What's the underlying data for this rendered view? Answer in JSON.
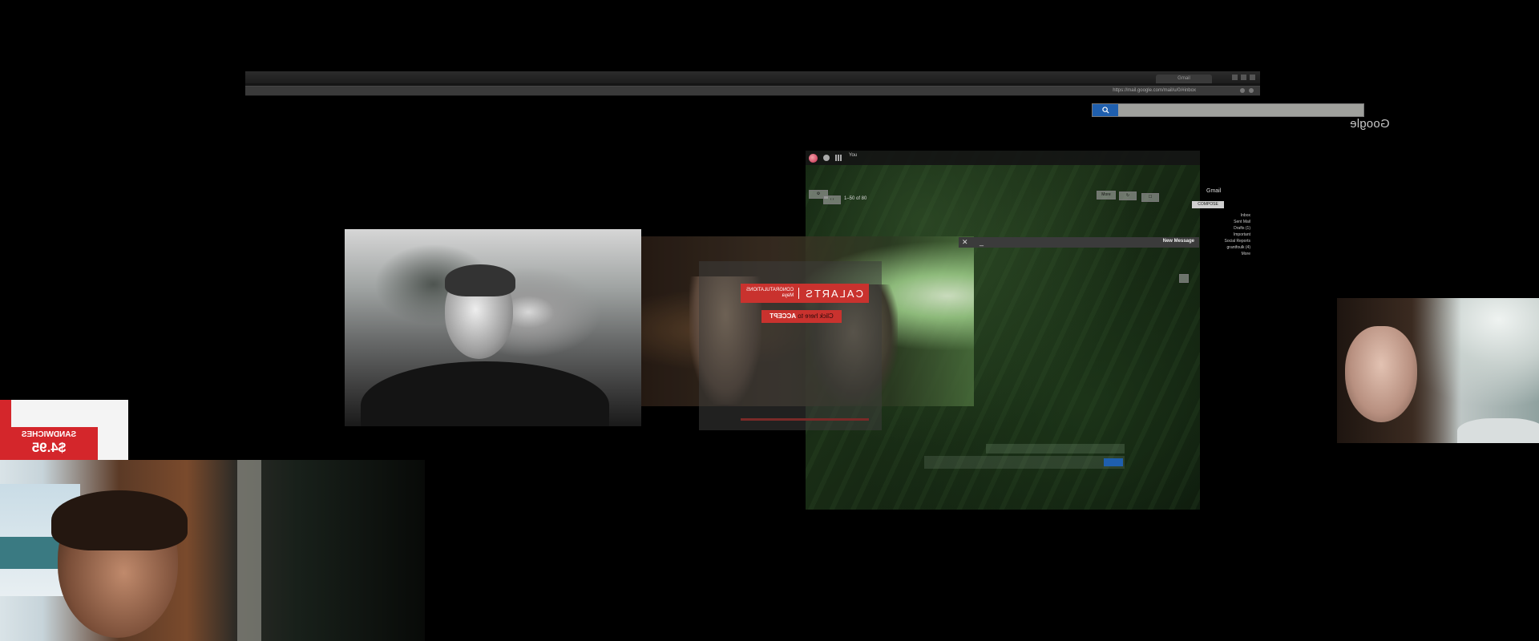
{
  "browser": {
    "tab_title": "Gmail",
    "address": "https://mail.google.com/mail/u/0/#inbox"
  },
  "google": {
    "logo": "Google",
    "search_placeholder": ""
  },
  "gmail": {
    "header_label": "Gmail",
    "compose_label": "COMPOSE",
    "folders": [
      "Inbox",
      "Sent Mail",
      "Drafts (1)",
      "Important",
      "Social Reports",
      "grantfoulk (4)",
      "More"
    ],
    "top_buttons": [
      "More",
      "",
      ""
    ],
    "page_indicator": "1–50 of 80",
    "user_label": "You"
  },
  "new_message": {
    "title": "New Message",
    "close": "✕",
    "minimize": "_"
  },
  "calarts": {
    "brand": "CALARTS",
    "congrats_line1": "CONGRATULATIONS",
    "congrats_line2": "Maya",
    "accept_prefix": "Click here to ",
    "accept_word": "ACCEPT"
  },
  "sign": {
    "line1": "SANDWICHES",
    "line2": "$4.95"
  },
  "colors": {
    "accent_red": "#c9322e",
    "search_blue": "#1f5fae",
    "background": "#000000"
  }
}
